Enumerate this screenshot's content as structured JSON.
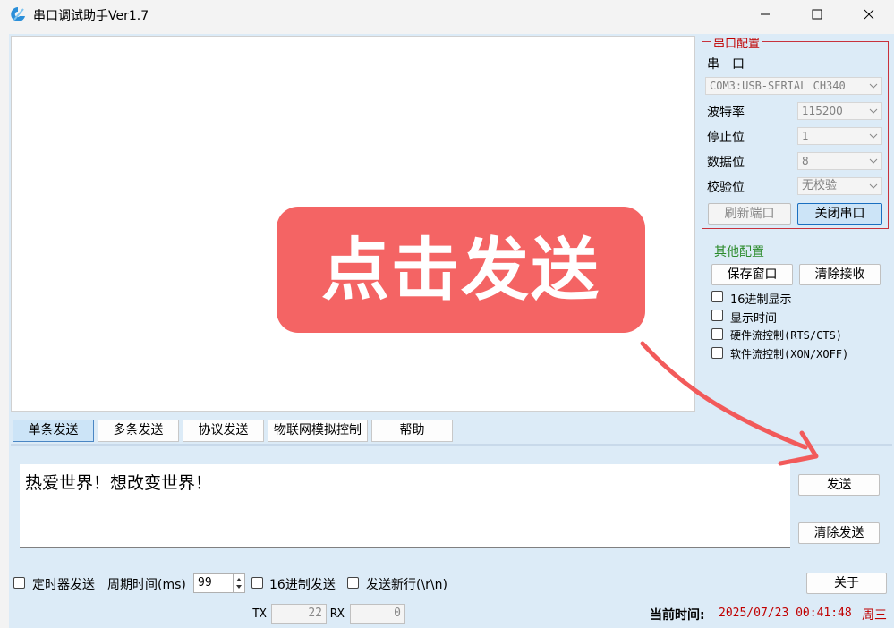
{
  "window": {
    "title": "串口调试助手Ver1.7"
  },
  "serial_config": {
    "group_title": "串口配置",
    "port_label": "串　口",
    "port_value": "COM3:USB-SERIAL CH340",
    "baud_label": "波特率",
    "baud_value": "115200",
    "stopbits_label": "停止位",
    "stopbits_value": "1",
    "databits_label": "数据位",
    "databits_value": "8",
    "parity_label": "校验位",
    "parity_value": "无校验",
    "refresh_label": "刷新端口",
    "close_label": "关闭串口"
  },
  "other_config": {
    "group_title": "其他配置",
    "save_window_label": "保存窗口",
    "clear_receive_label": "清除接收",
    "hex_display_label": "16进制显示",
    "show_time_label": "显示时间",
    "hw_flow_label": "硬件流控制(RTS/CTS)",
    "sw_flow_label": "软件流控制(XON/XOFF)"
  },
  "overlay": {
    "banner_text": "点击发送"
  },
  "tabs": [
    "单条发送",
    "多条发送",
    "协议发送",
    "物联网模拟控制",
    "帮助"
  ],
  "send": {
    "text": "热爱世界！想改变世界！",
    "send_label": "发送",
    "clear_send_label": "清除发送"
  },
  "bottom": {
    "timer_send_label": "定时器发送",
    "period_label": "周期时间(ms)",
    "period_value": "99",
    "hex_send_label": "16进制发送",
    "newline_label": "发送新行(\\r\\n)",
    "about_label": "关于",
    "tx_label": "TX",
    "tx_value": "22",
    "rx_label": "RX",
    "rx_value": "0",
    "time_label": "当前时间:",
    "time_value": "2025/07/23 00:41:48",
    "weekday": "周三"
  },
  "colors": {
    "accent_blue": "#cce4f7",
    "banner": "#f46464",
    "group_red": "#c8323c",
    "group_green": "#2a8a2a"
  }
}
